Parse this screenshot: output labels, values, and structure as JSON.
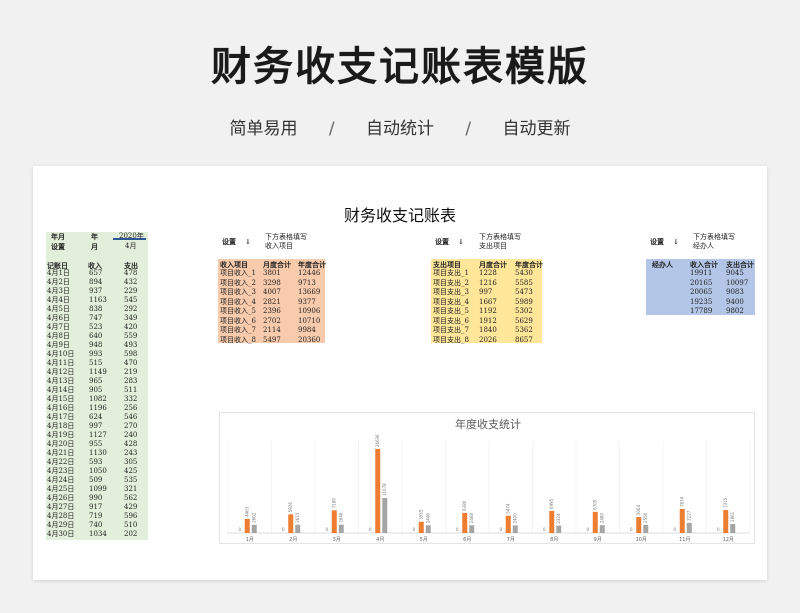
{
  "hero": {
    "title": "财务收支记账表模版",
    "tags": [
      "简单易用",
      "自动统计",
      "自动更新"
    ],
    "separator": "/"
  },
  "sheet": {
    "title": "财务收支记账表",
    "left": {
      "year_label": "年月",
      "setting_label": "设置",
      "year_col": "年",
      "month_col": "月",
      "year_value": "2020年",
      "month_value": "4月",
      "col_date": "记账日",
      "col_income": "收入",
      "col_expense": "支出",
      "rows": [
        [
          "4月1日",
          "657",
          "478"
        ],
        [
          "4月2日",
          "894",
          "432"
        ],
        [
          "4月3日",
          "937",
          "229"
        ],
        [
          "4月4日",
          "1163",
          "545"
        ],
        [
          "4月5日",
          "838",
          "292"
        ],
        [
          "4月6日",
          "747",
          "349"
        ],
        [
          "4月7日",
          "523",
          "420"
        ],
        [
          "4月8日",
          "640",
          "559"
        ],
        [
          "4月9日",
          "948",
          "493"
        ],
        [
          "4月10日",
          "993",
          "598"
        ],
        [
          "4月11日",
          "515",
          "470"
        ],
        [
          "4月12日",
          "1149",
          "219"
        ],
        [
          "4月13日",
          "965",
          "283"
        ],
        [
          "4月14日",
          "905",
          "511"
        ],
        [
          "4月15日",
          "1082",
          "332"
        ],
        [
          "4月16日",
          "1196",
          "256"
        ],
        [
          "4月17日",
          "624",
          "546"
        ],
        [
          "4月18日",
          "997",
          "270"
        ],
        [
          "4月19日",
          "1127",
          "240"
        ],
        [
          "4月20日",
          "955",
          "428"
        ],
        [
          "4月21日",
          "1130",
          "243"
        ],
        [
          "4月22日",
          "593",
          "305"
        ],
        [
          "4月23日",
          "1050",
          "425"
        ],
        [
          "4月24日",
          "509",
          "535"
        ],
        [
          "4月25日",
          "1099",
          "321"
        ],
        [
          "4月26日",
          "990",
          "562"
        ],
        [
          "4月27日",
          "917",
          "429"
        ],
        [
          "4月28日",
          "719",
          "596"
        ],
        [
          "4月29日",
          "740",
          "510"
        ],
        [
          "4月30日",
          "1034",
          "202"
        ]
      ]
    },
    "income": {
      "setting": "设置",
      "arrow": "↓",
      "note1": "下方表格填写",
      "note2": "收入项目",
      "headers": [
        "收入项目",
        "月度合计",
        "年度合计"
      ],
      "rows": [
        [
          "项目收入_1",
          "3801",
          "12446"
        ],
        [
          "项目收入_2",
          "3298",
          "9713"
        ],
        [
          "项目收入_3",
          "4007",
          "13669"
        ],
        [
          "项目收入_4",
          "2821",
          "9377"
        ],
        [
          "项目收入_5",
          "2396",
          "10906"
        ],
        [
          "项目收入_6",
          "2702",
          "10710"
        ],
        [
          "项目收入_7",
          "2114",
          "9984"
        ],
        [
          "项目收入_8",
          "5497",
          "20360"
        ]
      ]
    },
    "expense": {
      "setting": "设置",
      "arrow": "↓",
      "note1": "下方表格填写",
      "note2": "支出项目",
      "headers": [
        "支出项目",
        "月度合计",
        "年度合计"
      ],
      "rows": [
        [
          "项目支出_1",
          "1228",
          "5430"
        ],
        [
          "项目支出_2",
          "1216",
          "5585"
        ],
        [
          "项目支出_3",
          "997",
          "5473"
        ],
        [
          "项目支出_4",
          "1667",
          "5989"
        ],
        [
          "项目支出_5",
          "1192",
          "5302"
        ],
        [
          "项目支出_6",
          "1912",
          "5629"
        ],
        [
          "项目支出_7",
          "1840",
          "5362"
        ],
        [
          "项目支出_8",
          "2026",
          "8657"
        ]
      ]
    },
    "handler": {
      "setting": "设置",
      "arrow": "↓",
      "note1": "下方表格填写",
      "note2": "经办人",
      "headers": [
        "经办人",
        "收入合计",
        "支出合计"
      ],
      "rows": [
        [
          "",
          "19911",
          "9045"
        ],
        [
          "",
          "20165",
          "10097"
        ],
        [
          "",
          "20065",
          "9083"
        ],
        [
          "",
          "19235",
          "9400"
        ],
        [
          "",
          "17789",
          "9802"
        ]
      ]
    }
  },
  "chart_data": {
    "type": "bar",
    "title": "年度收支统计",
    "categories": [
      "1月",
      "2月",
      "3月",
      "4月",
      "5月",
      "6月",
      "7月",
      "8月",
      "9月",
      "10月",
      "11月",
      "12月"
    ],
    "series": [
      {
        "values": [
          0,
          4463,
          5926,
          7189,
          26636,
          3555,
          4380,
          5474,
          6995,
          6705,
          5064,
          7634,
          7315
        ],
        "color": "#ed7d31"
      },
      {
        "values": [
          0,
          2602,
          2615,
          2646,
          11078,
          2446,
          2468,
          2400,
          2324,
          2480,
          2550,
          3227,
          2861
        ],
        "color": "#a5a5a5"
      }
    ],
    "bars_income": [
      4463,
      5926,
      7189,
      26636,
      3555,
      6380,
      5474,
      6995,
      6705,
      5064,
      7634,
      7315
    ],
    "bars_expense": [
      2602,
      2615,
      2646,
      11078,
      2446,
      2468,
      2400,
      2324,
      2480,
      2550,
      3227,
      2861
    ],
    "zero_labels": [
      "0",
      "0",
      "0",
      "0",
      "0",
      "0",
      "0",
      "0",
      "0",
      "0",
      "0",
      "0"
    ],
    "colors": {
      "income": "#ed7d31",
      "expense": "#a5a5a5"
    }
  }
}
